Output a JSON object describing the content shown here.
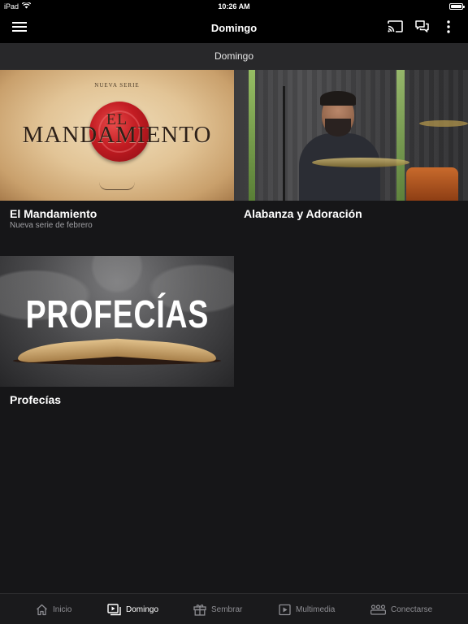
{
  "status_bar": {
    "device": "iPad",
    "time": "10:26 AM"
  },
  "nav": {
    "title": "Domingo"
  },
  "subheader": {
    "title": "Domingo"
  },
  "cards": [
    {
      "title": "El Mandamiento",
      "subtitle": "Nueva serie de febrero",
      "image_text": {
        "series": "NUEVA SERIE",
        "el": "EL",
        "main": "MANDAMIENTO"
      }
    },
    {
      "title": "Alabanza y Adoración",
      "subtitle": ""
    },
    {
      "title": "Profecías",
      "subtitle": "",
      "image_text": {
        "main": "PROFECÍAS"
      }
    }
  ],
  "tabs": [
    {
      "label": "Inicio",
      "icon": "home-icon",
      "active": false
    },
    {
      "label": "Domingo",
      "icon": "video-icon",
      "active": true
    },
    {
      "label": "Sembrar",
      "icon": "gift-icon",
      "active": false
    },
    {
      "label": "Multimedia",
      "icon": "play-icon",
      "active": false
    },
    {
      "label": "Conectarse",
      "icon": "people-icon",
      "active": false
    }
  ],
  "colors": {
    "background": "#161618",
    "bar": "#000000",
    "subheader": "#28282a",
    "tab_inactive": "#8e8e93",
    "seal_red": "#c21c22"
  }
}
